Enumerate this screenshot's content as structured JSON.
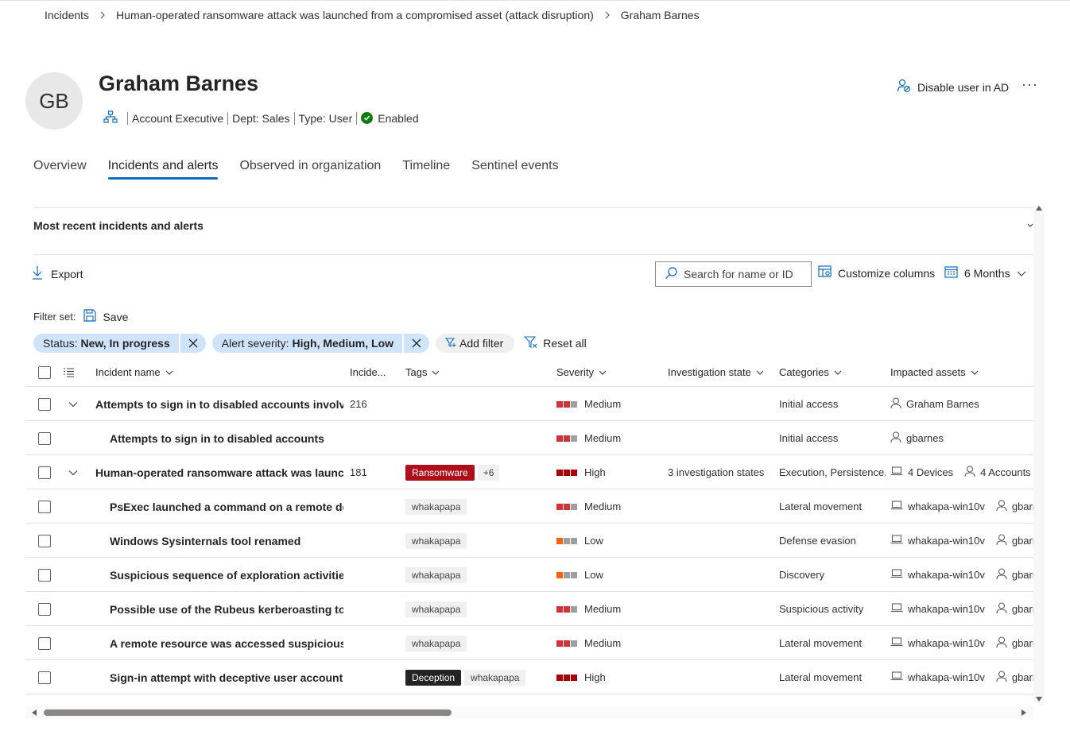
{
  "breadcrumb": {
    "items": [
      "Incidents",
      "Human-operated ransomware attack was launched from a compromised asset (attack disruption)",
      "Graham Barnes"
    ]
  },
  "user": {
    "initials": "GB",
    "name": "Graham Barnes",
    "title": "Account Executive",
    "dept": "Dept: Sales",
    "type": "Type: User",
    "status": "Enabled"
  },
  "actions": {
    "disable_label": "Disable user in AD",
    "more_label": "···"
  },
  "tabs": [
    {
      "label": "Overview",
      "active": false
    },
    {
      "label": "Incidents and alerts",
      "active": true
    },
    {
      "label": "Observed in organization",
      "active": false
    },
    {
      "label": "Timeline",
      "active": false
    },
    {
      "label": "Sentinel events",
      "active": false
    }
  ],
  "section": {
    "title": "Most recent incidents and alerts"
  },
  "toolbar": {
    "export_label": "Export",
    "search_placeholder": "Search for name or ID",
    "customize_label": "Customize columns",
    "months_label": "6 Months"
  },
  "filters": {
    "filterset_label": "Filter set:",
    "save_label": "Save",
    "chips": [
      {
        "key": "Status: ",
        "value": "New, In progress"
      },
      {
        "key": "Alert severity: ",
        "value": "High, Medium, Low"
      }
    ],
    "add_filter_label": "Add filter",
    "reset_label": "Reset all"
  },
  "table": {
    "headers": {
      "name": "Incident name",
      "incident_id": "Incide...",
      "tags": "Tags",
      "severity": "Severity",
      "investigation": "Investigation state",
      "categories": "Categories",
      "assets": "Impacted assets"
    },
    "rows": [
      {
        "level": 0,
        "name": "Attempts to sign in to disabled accounts involvi...",
        "id": "216",
        "tags": [],
        "severity": "Medium",
        "investigation": "",
        "category": "Initial access",
        "assets": [
          {
            "kind": "user",
            "label": "Graham Barnes"
          }
        ]
      },
      {
        "level": 1,
        "name": "Attempts to sign in to disabled accounts",
        "id": "",
        "tags": [],
        "severity": "Medium",
        "investigation": "",
        "category": "Initial access",
        "assets": [
          {
            "kind": "user",
            "label": "gbarnes"
          }
        ]
      },
      {
        "level": 0,
        "name": "Human-operated ransomware attack was launc...",
        "id": "181",
        "tags": [
          {
            "style": "ransom",
            "label": "Ransomware"
          },
          {
            "style": "plus",
            "label": "+6"
          }
        ],
        "severity": "High",
        "investigation": "3 investigation states",
        "category": "Execution, Persistence, ...",
        "assets": [
          {
            "kind": "device",
            "label": "4 Devices"
          },
          {
            "kind": "user",
            "label": "4 Accounts"
          }
        ]
      },
      {
        "level": 1,
        "name": "PsExec launched a command on a remote de...",
        "id": "",
        "tags": [
          {
            "style": "plain",
            "label": "whakapapa"
          }
        ],
        "severity": "Medium",
        "investigation": "",
        "category": "Lateral movement",
        "assets": [
          {
            "kind": "device",
            "label": "whakapa-win10v"
          },
          {
            "kind": "user",
            "label": "gbarne"
          }
        ]
      },
      {
        "level": 1,
        "name": "Windows Sysinternals tool renamed",
        "id": "",
        "tags": [
          {
            "style": "plain",
            "label": "whakapapa"
          }
        ],
        "severity": "Low",
        "investigation": "",
        "category": "Defense evasion",
        "assets": [
          {
            "kind": "device",
            "label": "whakapa-win10v"
          },
          {
            "kind": "user",
            "label": "gbarne"
          }
        ]
      },
      {
        "level": 1,
        "name": "Suspicious sequence of exploration activities",
        "id": "",
        "tags": [
          {
            "style": "plain",
            "label": "whakapapa"
          }
        ],
        "severity": "Low",
        "investigation": "",
        "category": "Discovery",
        "assets": [
          {
            "kind": "device",
            "label": "whakapa-win10v"
          },
          {
            "kind": "user",
            "label": "gbarne"
          }
        ]
      },
      {
        "level": 1,
        "name": "Possible use of the Rubeus kerberoasting tool",
        "id": "",
        "tags": [
          {
            "style": "plain",
            "label": "whakapapa"
          }
        ],
        "severity": "Medium",
        "investigation": "",
        "category": "Suspicious activity",
        "assets": [
          {
            "kind": "device",
            "label": "whakapa-win10v"
          },
          {
            "kind": "user",
            "label": "gbarne"
          }
        ]
      },
      {
        "level": 1,
        "name": "A remote resource was accessed suspiciously",
        "id": "",
        "tags": [
          {
            "style": "plain",
            "label": "whakapapa"
          }
        ],
        "severity": "Medium",
        "investigation": "",
        "category": "Lateral movement",
        "assets": [
          {
            "kind": "device",
            "label": "whakapa-win10v"
          },
          {
            "kind": "user",
            "label": "gbarne"
          }
        ]
      },
      {
        "level": 1,
        "name": "Sign-in attempt with deceptive user account",
        "id": "",
        "tags": [
          {
            "style": "decept",
            "label": "Deception"
          },
          {
            "style": "plain",
            "label": "whakapapa"
          }
        ],
        "severity": "High",
        "investigation": "",
        "category": "Lateral movement",
        "assets": [
          {
            "kind": "device",
            "label": "whakapa-win10v"
          },
          {
            "kind": "user",
            "label": "gbarne"
          }
        ]
      }
    ]
  },
  "colors": {
    "accent": "#0f6cbd",
    "sev_high": "#a80000",
    "sev_medium": "#d13438",
    "sev_low": "#f7630c",
    "sev_empty": "#a19f9d",
    "enabled": "#107c10"
  },
  "icons": [
    "chevron-right-icon",
    "org-chart-icon",
    "check-circle-icon",
    "person-block-icon",
    "download-icon",
    "search-icon",
    "columns-icon",
    "calendar-icon",
    "chevron-down-icon",
    "save-icon",
    "dismiss-icon",
    "filter-add-icon",
    "filter-reset-icon",
    "list-icon",
    "person-icon",
    "laptop-icon"
  ]
}
